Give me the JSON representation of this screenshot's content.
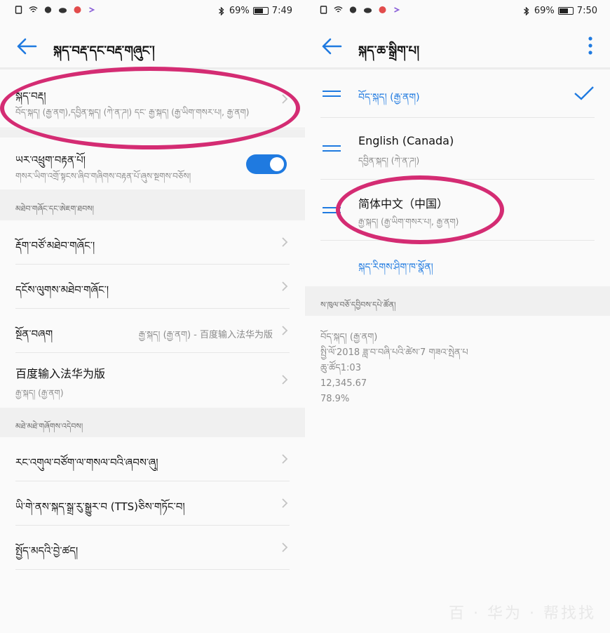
{
  "left": {
    "status": {
      "battery": "69%",
      "time": "7:49"
    },
    "title": "སྐད་བརྡ་དང་བརྡ་གཞུང་།",
    "rows": {
      "language": {
        "title": "སྐད་བརྡ།",
        "sub": "བོད་སྐད། (རྒྱ་ནག),དབྱིན་སྐད། (ཀེ་ན་ཌ།) དང་ རྒྱ་སྐད། (རྒྱ་ཡིག་གསར་པ།, རྒྱ་ནག)"
      },
      "regional": {
        "title": "ཡར་འཕྲུག་བརྟན་པོ།",
        "sub": "གསར་ཡིག་འགྲོ་སྟངས་ཞིབ་གཞིགས་བརྟན་པོ་ཞུས་སྔགས་བཅོས།"
      },
      "section1": "མཐེབ་གཞོང་དང་ཨེཇག་ཐབས།",
      "keyboard": {
        "title": "རྡོག་བཙོ་མཐེབ་གཞོང་།"
      },
      "physical": {
        "title": "དངོས་ལུགས་མཐེབ་གཞོང་།"
      },
      "default_method": {
        "title": "སྔོན་བཞག",
        "value": "རྒྱ་སྐད། (རྒྱ་ནག) - 百度输入法华为版"
      },
      "baidu": {
        "title": "百度输入法华为版",
        "sub": "རྒྱ་སྐད། (རྒྱ་ནག)"
      },
      "section2": "མཐེ་མཐེ་གཞོགས་འདེབས།",
      "autofill": {
        "title": "རང་འགུལ་བཙོག་ལ་གསལ་བའི་ཞབས་ཞུ།"
      },
      "tts": {
        "title": "ཡི་གེ་ནས་སྐད་སྒྲ་རུ་སྒྱུར་བ (TTS)ཅིས་གཏོང་བ།"
      },
      "pointer": {
        "title": "སྤྱོད་མདའི་བྱེ་ཚད།"
      }
    }
  },
  "right": {
    "status": {
      "battery": "69%",
      "time": "7:50"
    },
    "title": "སྐད་ཆ་སྒྲིག་པ།",
    "languages": [
      {
        "title": "བོད་སྐད། (རྒྱ་ནག)",
        "sub": ""
      },
      {
        "title": "English (Canada)",
        "sub": "དབྱིན་སྐད། (ཀེ་ན་ཌ།)"
      },
      {
        "title": "简体中文（中国）",
        "sub": "རྒྱ་སྐད། (རྒྱ་ཡིག་གསར་པ།, རྒྱ་ནག)"
      }
    ],
    "add_language": "སྐད་རིགས་ཤིག་ཁ་སྣོན།",
    "preview_section": "ས་ཁུལ་བཅོ་དབྱིབས་དཔེ་ཚོན།",
    "preview": {
      "language": "བོད་སྐད། (རྒྱ་ནག)",
      "date": "སྤྱི་ལོ་2018 ཟླ་བ་བཞི་པའི་ཚེས་7 གཟའ་སྤེན་པ",
      "time": "ཆུ་ཚོད1:03",
      "number": "12,345.67",
      "percent": "78.9%"
    },
    "watermark": "百 · 华为 · 帮找找"
  },
  "colors": {
    "accent": "#1f7ae0",
    "highlight": "#d42c73"
  }
}
